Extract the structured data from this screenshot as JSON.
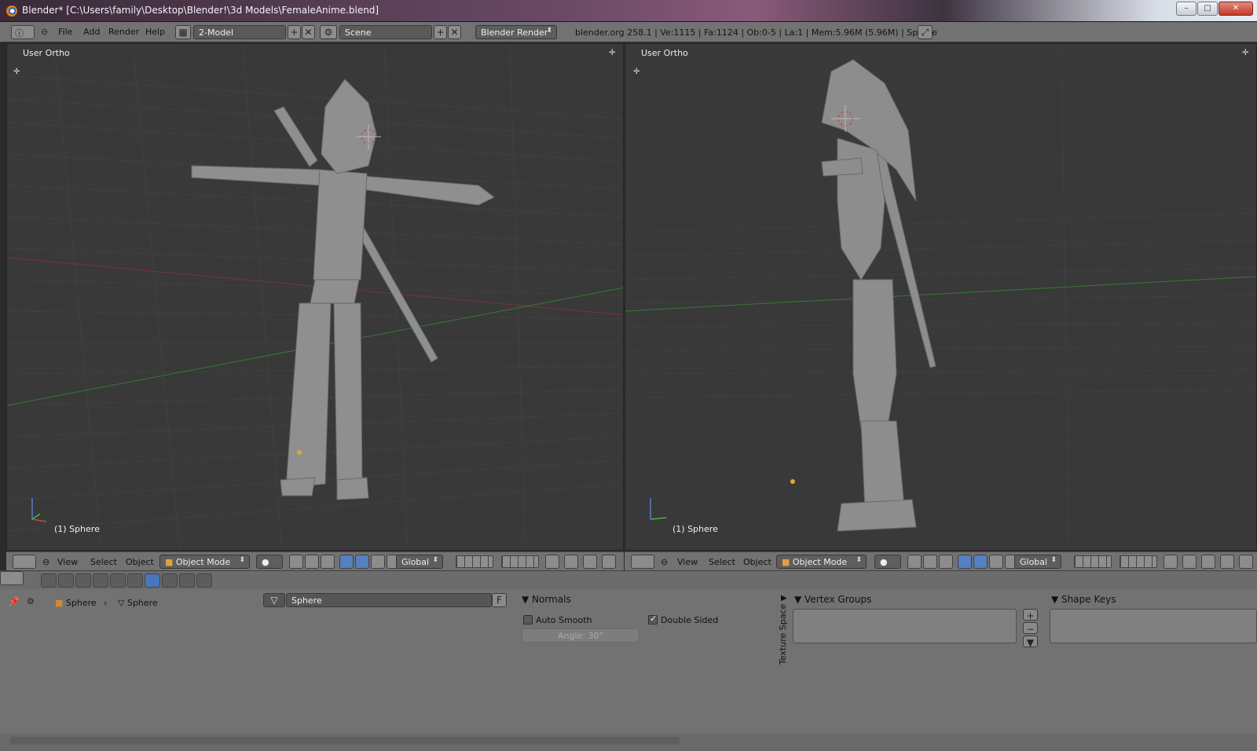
{
  "window": {
    "title": "Blender* [C:\\Users\\family\\Desktop\\Blender!\\3d Models\\FemaleAnime.blend]"
  },
  "info_header": {
    "menus": [
      "File",
      "Add",
      "Render",
      "Help"
    ],
    "screen_layout": "2-Model",
    "scene": "Scene",
    "render_engine": "Blender Render",
    "stats": "blender.org 258.1 | Ve:1115 | Fa:1124 | Ob:0-5 | La:1 | Mem:5.96M (5.96M) | Sphere"
  },
  "viewports": [
    {
      "label": "User Ortho",
      "object_label": "(1) Sphere"
    },
    {
      "label": "User Ortho",
      "object_label": "(1) Sphere"
    }
  ],
  "view_header": {
    "menus": [
      "View",
      "Select",
      "Object"
    ],
    "mode": "Object Mode",
    "orientation": "Global"
  },
  "properties": {
    "breadcrumb": [
      "Sphere",
      "Sphere"
    ],
    "datablock_name": "Sphere",
    "fake_user": "F",
    "normals_panel": {
      "title": "Normals",
      "auto_smooth": "Auto Smooth",
      "double_sided": "Double Sided",
      "auto_smooth_checked": false,
      "double_sided_checked": true,
      "angle": "Angle: 30°"
    },
    "texture_space_tab": "Texture Space",
    "vertex_groups_title": "Vertex Groups",
    "shape_keys_title": "Shape Keys"
  },
  "colors": {
    "accent_blue": "#5680c2",
    "viewport_bg": "#393939",
    "header_bg": "#727272",
    "axis_red": "#8a3030",
    "axis_green": "#3a8a3a"
  },
  "icons": [
    "blender-icon",
    "info-icon",
    "screen-layout-icon",
    "scene-icon",
    "fullscreen-icon",
    "cube-icon",
    "mesh-icon",
    "pin-icon",
    "plus-icon",
    "minus-icon",
    "down-arrow-icon"
  ]
}
